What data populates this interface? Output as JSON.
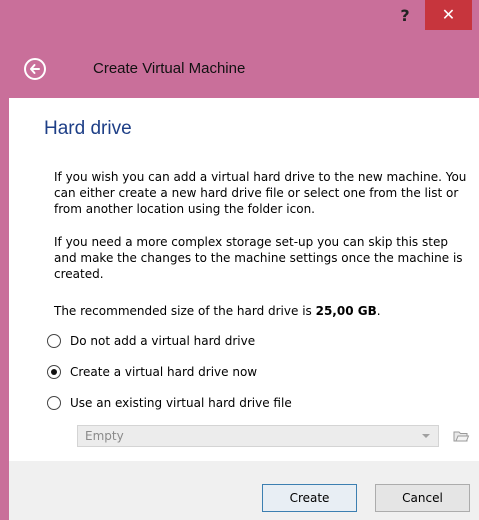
{
  "titlebar": {
    "help_label": "?",
    "close_label": "✕"
  },
  "header": {
    "title": "Create Virtual Machine",
    "back_icon": "back-arrow-icon"
  },
  "section": {
    "title": "Hard drive",
    "paragraph1": "If you wish you can add a virtual hard drive to the new machine. You can either create a new hard drive file or select one from the list or from another location using the folder icon.",
    "paragraph2": "If you need a more complex storage set-up you can skip this step and make the changes to the machine settings once the machine is created.",
    "recommended_prefix": "The recommended size of the hard drive is ",
    "recommended_size": "25,00 GB",
    "recommended_suffix": "."
  },
  "options": [
    {
      "label": "Do not add a virtual hard drive",
      "checked": false
    },
    {
      "label": "Create a virtual hard drive now",
      "checked": true
    },
    {
      "label": "Use an existing virtual hard drive file",
      "checked": false
    }
  ],
  "existing_file_select": {
    "value": "Empty",
    "enabled": false,
    "folder_icon": "folder-icon"
  },
  "footer": {
    "create_label": "Create",
    "cancel_label": "Cancel"
  },
  "colors": {
    "window_frame": "#c96f9a",
    "close_button": "#c7353d",
    "section_title": "#1e3f87",
    "default_button_border": "#3c7fb1"
  }
}
